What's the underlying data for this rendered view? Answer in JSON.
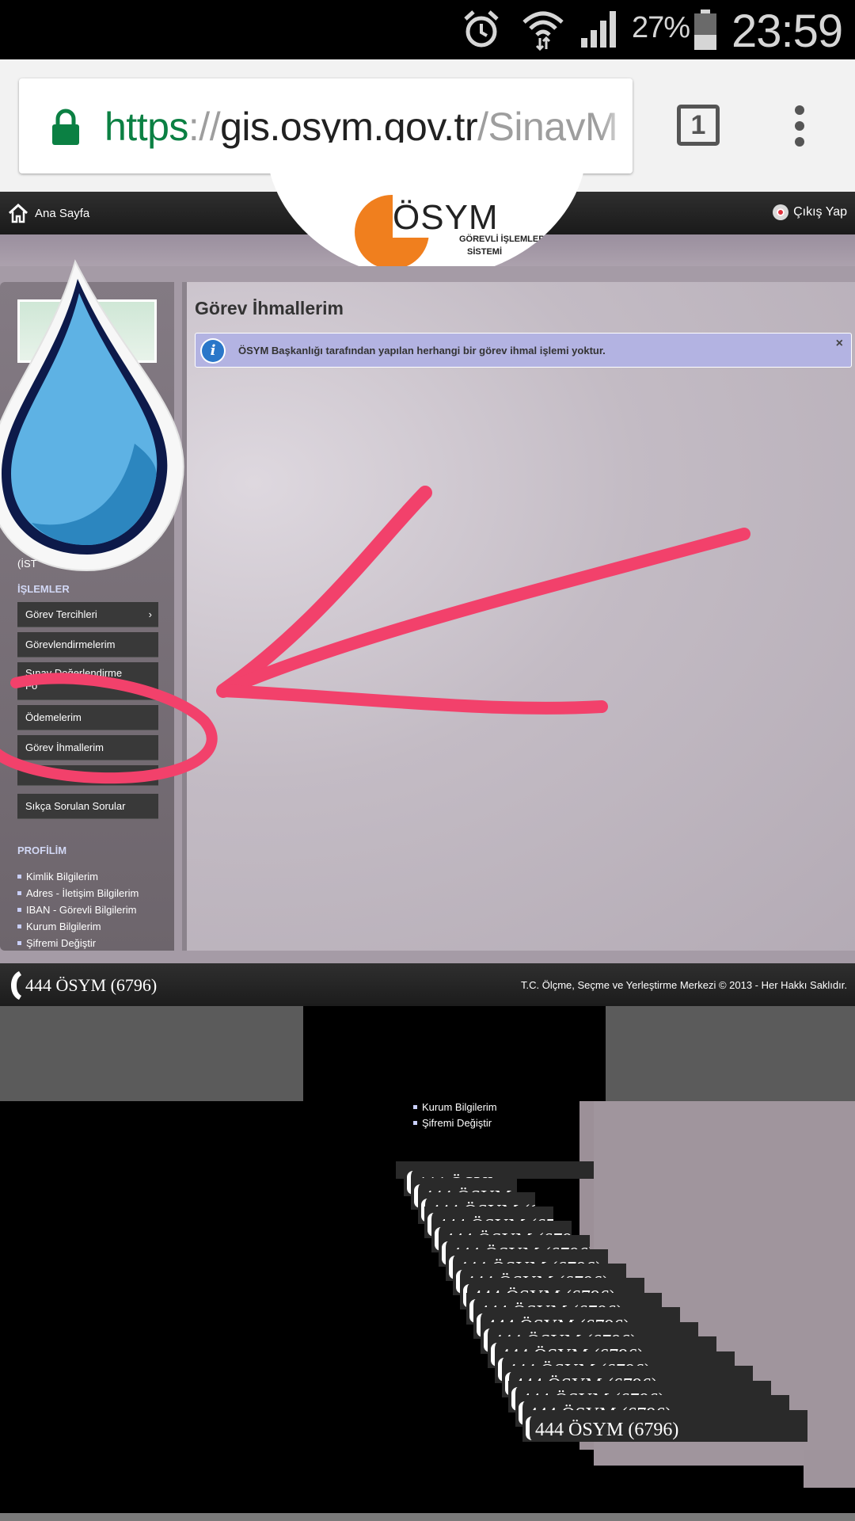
{
  "status_bar": {
    "battery_percent": "27%",
    "time": "23:59"
  },
  "browser": {
    "url_scheme": "https",
    "url_separator": "://",
    "url_host": "gis.osym.gov.tr",
    "url_path": "/SinavM",
    "tab_count": "1"
  },
  "header": {
    "home_label": "Ana Sayfa",
    "logout_label": "Çıkış Yap",
    "logo_title": "ÖSYM",
    "logo_subtitle_1": "GÖREVLİ İŞLEMLERİ",
    "logo_subtitle_2": "SİSTEMİ"
  },
  "sidebar": {
    "truncated_name": "(İST",
    "operations_title": "İŞLEMLER",
    "operations": [
      {
        "label": "Görev Tercihleri"
      },
      {
        "label": "Görevlendirmelerim"
      },
      {
        "label": "Sınav Değerlendirme"
      },
      {
        "label": "Ödemelerim"
      },
      {
        "label": "Görev İhmallerim"
      },
      {
        "label": "Sıkça Sorulan Sorular"
      }
    ],
    "truncated_second_line": "Fo",
    "profile_title": "PROFİLİM",
    "profile_links": [
      {
        "label": "Kimlik Bilgilerim"
      },
      {
        "label": "Adres - İletişim Bilgilerim"
      },
      {
        "label": "IBAN - Görevli Bilgilerim"
      },
      {
        "label": "Kurum Bilgilerim"
      },
      {
        "label": "Şifremi Değiştir"
      }
    ]
  },
  "content": {
    "page_title": "Görev İhmallerim",
    "alert_text": "ÖSYM Başkanlığı tarafından yapılan herhangi bir görev ihmal işlemi yoktur.",
    "alert_close": "×"
  },
  "footer": {
    "phone": "444 ÖSYM (6796)",
    "copyright": "T.C. Ölçme, Seçme ve Yerleştirme Merkezi © 2013 - Her Hakkı Saklıdır."
  },
  "glitch": {
    "ghost_link_1": "Kurum Bilgilerim",
    "ghost_link_2": "Şifremi Değiştir",
    "ghost_phone": "444 ÖSYM (6796)"
  },
  "colors": {
    "annotation": "#f2416b",
    "url_secure": "#0b8043",
    "brand_orange": "#f07f1e",
    "sidebar_heading": "#d2d8f5",
    "alert_bg": "#b3b3e2"
  }
}
